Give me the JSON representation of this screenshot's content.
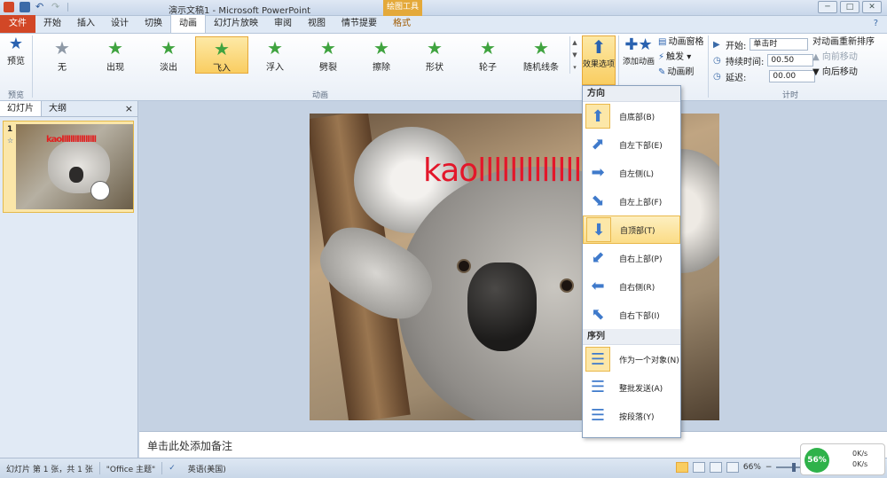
{
  "window": {
    "title": "演示文稿1 - Microsoft PowerPoint",
    "context_group": "绘图工具",
    "buttons": [
      "─",
      "□",
      "✕"
    ]
  },
  "tabs": [
    {
      "label": "文件",
      "kind": "file"
    },
    {
      "label": "开始"
    },
    {
      "label": "插入"
    },
    {
      "label": "设计"
    },
    {
      "label": "切换"
    },
    {
      "label": "动画",
      "kind": "active"
    },
    {
      "label": "幻灯片放映"
    },
    {
      "label": "审阅"
    },
    {
      "label": "视图"
    },
    {
      "label": "情节提要"
    },
    {
      "label": "格式",
      "kind": "ctx"
    }
  ],
  "ribbon": {
    "preview": {
      "label": "预览",
      "group": "预览",
      "icon": "star-play-icon"
    },
    "animations": [
      {
        "label": "无",
        "icon": "star-none-icon"
      },
      {
        "label": "出现",
        "icon": "star-icon"
      },
      {
        "label": "淡出",
        "icon": "star-icon"
      },
      {
        "label": "飞入",
        "icon": "star-icon",
        "selected": true
      },
      {
        "label": "浮入",
        "icon": "star-icon"
      },
      {
        "label": "劈裂",
        "icon": "star-icon"
      },
      {
        "label": "擦除",
        "icon": "star-icon"
      },
      {
        "label": "形状",
        "icon": "star-icon"
      },
      {
        "label": "轮子",
        "icon": "star-icon"
      },
      {
        "label": "随机线条",
        "icon": "star-icon"
      }
    ],
    "animation_group": "动画",
    "effect_options": "效果选项",
    "add_animation": "添加动画",
    "anim_pane": "动画窗格",
    "trigger": "触发",
    "anim_painter": "动画刷",
    "timing": {
      "start_label": "开始:",
      "start_value": "单击时",
      "duration_label": "持续时间:",
      "duration_value": "00.50",
      "delay_label": "延迟:",
      "delay_value": "00.00",
      "group": "计时"
    },
    "reorder": {
      "title": "对动画重新排序",
      "forward": "向前移动",
      "backward": "向后移动"
    }
  },
  "left_pane": {
    "tabs": [
      "幻灯片",
      "大纲"
    ],
    "close": "×",
    "slide_number": "1",
    "thumb_text": "kaollllllllllllllll"
  },
  "slide": {
    "text": "kaollllllllllllll"
  },
  "notes_placeholder": "单击此处添加备注",
  "dropdown": {
    "direction_header": "方向",
    "directions": [
      {
        "label": "自底部(B)",
        "icon": "arrow-up-icon",
        "glyph": "⬆",
        "selected": true
      },
      {
        "label": "自左下部(E)",
        "icon": "arrow-upright-icon",
        "glyph": "⬈"
      },
      {
        "label": "自左侧(L)",
        "icon": "arrow-right-icon",
        "glyph": "➡"
      },
      {
        "label": "自左上部(F)",
        "icon": "arrow-downright-icon",
        "glyph": "⬊"
      },
      {
        "label": "自顶部(T)",
        "icon": "arrow-down-icon",
        "glyph": "⬇",
        "highlight": true
      },
      {
        "label": "自右上部(P)",
        "icon": "arrow-downleft-icon",
        "glyph": "⬋"
      },
      {
        "label": "自右侧(R)",
        "icon": "arrow-left-icon",
        "glyph": "⬅"
      },
      {
        "label": "自右下部(I)",
        "icon": "arrow-upleft-icon",
        "glyph": "⬉"
      }
    ],
    "sequence_header": "序列",
    "sequences": [
      {
        "label": "作为一个对象(N)",
        "icon": "list-icon",
        "selected": true
      },
      {
        "label": "整批发送(A)",
        "icon": "list-icon"
      },
      {
        "label": "按段落(Y)",
        "icon": "list-icon"
      }
    ]
  },
  "status_bar": {
    "slide_info": "幻灯片 第 1 张，共 1 张",
    "theme": "\"Office 主题\"",
    "language": "英语(美国)",
    "zoom": "66%"
  },
  "net_widget": {
    "percent": "56%",
    "up": "0K/s",
    "down": "0K/s"
  }
}
